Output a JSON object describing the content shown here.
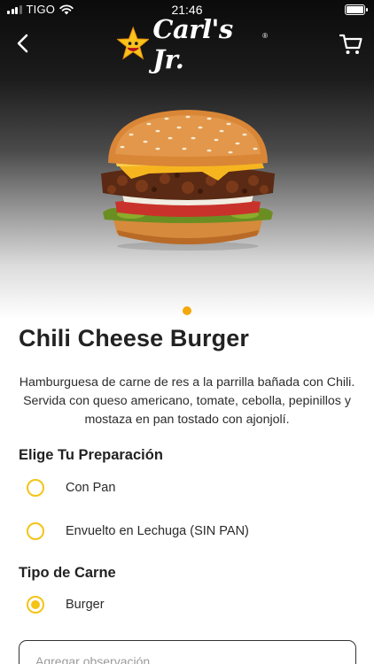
{
  "status_bar": {
    "carrier": "TIGO",
    "time": "21:46",
    "battery_level_percent": 100,
    "icons": [
      "signal-icon",
      "wifi-icon",
      "battery-icon"
    ]
  },
  "nav": {
    "back_icon": "chevron-left-icon",
    "brand": "Carl's Jr.",
    "brand_reg": "®",
    "cart_icon": "shopping-cart-icon"
  },
  "product": {
    "image": "chili-cheese-burger-photo",
    "carousel_pages": 1,
    "carousel_active": 1,
    "title": "Chili Cheese Burger",
    "description": "Hamburguesa de carne de res a la parrilla bañada con Chili. Servida con queso americano, tomate, cebolla, pepinillos y mostaza en pan tostado con ajonjolí."
  },
  "preparation": {
    "title": "Elige Tu Preparación",
    "options": [
      {
        "label": "Con Pan",
        "selected": false
      },
      {
        "label": "Envuelto en Lechuga (SIN PAN)",
        "selected": false
      }
    ]
  },
  "meat": {
    "title": "Tipo de Carne",
    "options": [
      {
        "label": "Burger",
        "selected": true
      }
    ]
  },
  "note": {
    "placeholder": "Agregar observación",
    "value": ""
  },
  "colors": {
    "accent": "#f4c417",
    "dot": "#f4a80c",
    "hero_top": "#0b0b0b",
    "text": "#222222"
  }
}
